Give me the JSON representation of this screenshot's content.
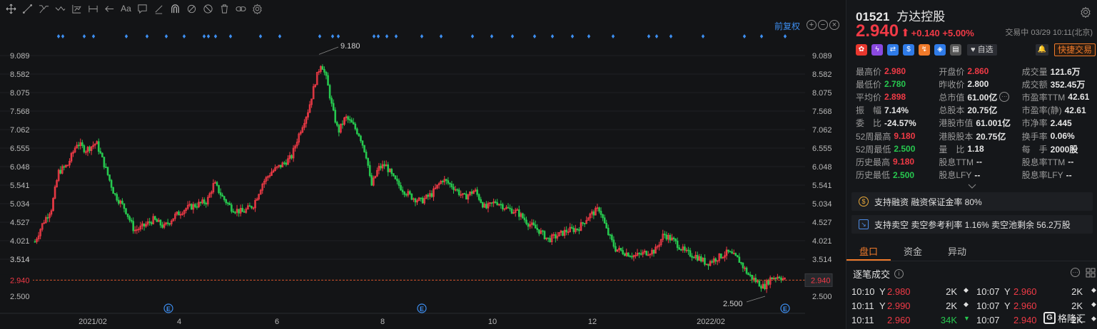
{
  "toolbar": {
    "tools": [
      "move-tool",
      "line-tool",
      "ray-tool",
      "path-tool",
      "fib-tool",
      "measure-tool",
      "undo-tool",
      "text-tool",
      "comment-tool",
      "brush-tool",
      "magnet-tool",
      "visibility-tool",
      "trash-tool",
      "link-tool",
      "settings-tool"
    ],
    "text_tool_label": "Aa"
  },
  "chart": {
    "restore_label": "前复权",
    "zoom_in": "+",
    "zoom_out": "−",
    "y_ticks": [
      "9.089",
      "8.582",
      "8.075",
      "7.568",
      "7.062",
      "6.555",
      "6.048",
      "5.541",
      "5.034",
      "4.527",
      "4.021",
      "3.514"
    ],
    "y_ticks_lower": "2.500",
    "x_ticks": [
      "2021/02",
      "4",
      "6",
      "8",
      "10",
      "12",
      "2022/02"
    ],
    "current_price_label": "2.940",
    "high_label": "9.180",
    "low_label": "2.500",
    "event_marker": "E",
    "colors": {
      "up": "#f03a46",
      "down": "#27c84f",
      "background": "#131416",
      "marker": "#3d8ef0"
    }
  },
  "stock": {
    "code": "01521",
    "name": "方达控股",
    "price": "2.940",
    "change": "+0.140",
    "change_pct": "+5.00%",
    "status": "交易中 03/29 10:11(北京)",
    "fav_label": "自选",
    "quick_trade_label": "快捷交易"
  },
  "stats": [
    [
      {
        "l": "最高价",
        "v": "2.980",
        "c": "up"
      },
      {
        "l": "开盘价",
        "v": "2.860",
        "c": "up"
      },
      {
        "l": "成交量",
        "v": "121.6万",
        "c": ""
      }
    ],
    [
      {
        "l": "最低价",
        "v": "2.780",
        "c": "dn"
      },
      {
        "l": "昨收价",
        "v": "2.800",
        "c": ""
      },
      {
        "l": "成交额",
        "v": "352.45万",
        "c": ""
      }
    ],
    [
      {
        "l": "平均价",
        "v": "2.898",
        "c": "up"
      },
      {
        "l": "总市值",
        "v": "61.00亿",
        "c": ""
      },
      {
        "l": "市盈率TTM",
        "v": "42.61",
        "c": ""
      }
    ],
    [
      {
        "l": "振　幅",
        "v": "7.14%",
        "c": ""
      },
      {
        "l": "总股本",
        "v": "20.75亿",
        "c": ""
      },
      {
        "l": "市盈率(静)",
        "v": "42.61",
        "c": ""
      }
    ],
    [
      {
        "l": "委　比",
        "v": "-24.57%",
        "c": ""
      },
      {
        "l": "港股市值",
        "v": "61.001亿",
        "c": ""
      },
      {
        "l": "市净率",
        "v": "2.445",
        "c": ""
      }
    ],
    [
      {
        "l": "52周最高",
        "v": "9.180",
        "c": "up"
      },
      {
        "l": "港股股本",
        "v": "20.75亿",
        "c": ""
      },
      {
        "l": "换手率",
        "v": "0.06%",
        "c": ""
      }
    ],
    [
      {
        "l": "52周最低",
        "v": "2.500",
        "c": "dn"
      },
      {
        "l": "量　比",
        "v": "1.18",
        "c": ""
      },
      {
        "l": "每　手",
        "v": "2000股",
        "c": ""
      }
    ],
    [
      {
        "l": "历史最高",
        "v": "9.180",
        "c": "up"
      },
      {
        "l": "股息TTM",
        "v": "--",
        "c": ""
      },
      {
        "l": "股息率TTM",
        "v": "--",
        "c": ""
      }
    ],
    [
      {
        "l": "历史最低",
        "v": "2.500",
        "c": "dn"
      },
      {
        "l": "股息LFY",
        "v": "--",
        "c": ""
      },
      {
        "l": "股息率LFY",
        "v": "--",
        "c": ""
      }
    ]
  ],
  "features": {
    "margin": "支持融资  融资保证金率 80%",
    "short": "支持卖空  卖空参考利率 1.16%  卖空池剩余 56.2万股"
  },
  "tabs": [
    "盘口",
    "资金",
    "异动"
  ],
  "trades": {
    "title": "逐笔成交",
    "rows": [
      {
        "t1": "10:10",
        "y1": "Y",
        "p1": "2.980",
        "v1": "2K",
        "m1": "◆",
        "t2": "10:07",
        "y2": "Y",
        "p2": "2.960",
        "v2": "2K",
        "m2": "◆"
      },
      {
        "t1": "10:11",
        "y1": "Y",
        "p1": "2.990",
        "v1": "2K",
        "m1": "◆",
        "t2": "10:07",
        "y2": "Y",
        "p2": "2.960",
        "v2": "2K",
        "m2": "◆"
      },
      {
        "t1": "10:11",
        "y1": "",
        "p1": "2.960",
        "v1": "34K",
        "m1": "▼",
        "t2": "10:07",
        "y2": "",
        "p2": "2.940",
        "v2": "2K",
        "m2": "◆"
      }
    ]
  },
  "brand": "格隆汇"
}
